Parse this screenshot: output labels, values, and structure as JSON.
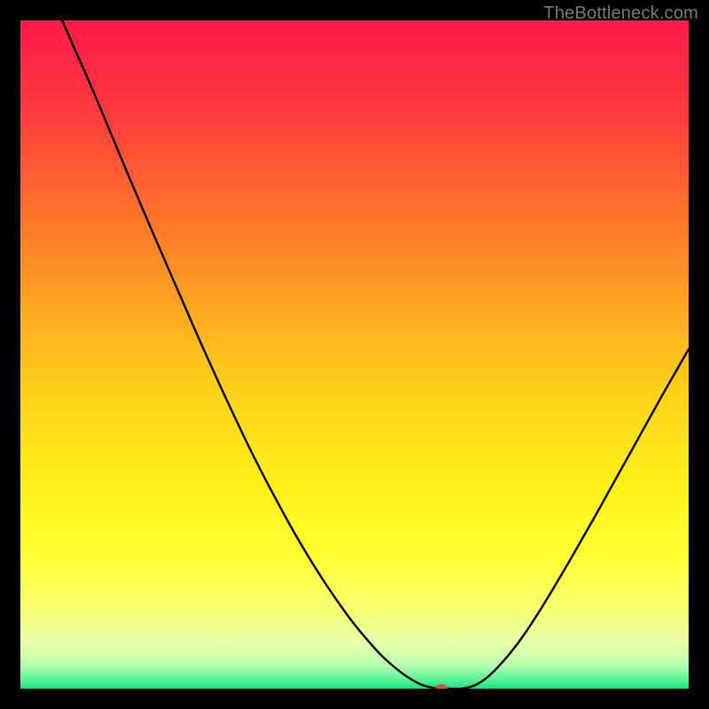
{
  "watermark": "TheBottleneck.com",
  "colors": {
    "marker_fill": "#c15a4d",
    "curve_stroke": "#000000",
    "gradient_stops": [
      {
        "offset": 0.0,
        "color": "#ff1a49"
      },
      {
        "offset": 0.14,
        "color": "#ff3b3e"
      },
      {
        "offset": 0.28,
        "color": "#ff6f2c"
      },
      {
        "offset": 0.42,
        "color": "#ffa322"
      },
      {
        "offset": 0.56,
        "color": "#ffd21a"
      },
      {
        "offset": 0.7,
        "color": "#fff01a"
      },
      {
        "offset": 0.8,
        "color": "#ffff33"
      },
      {
        "offset": 0.88,
        "color": "#f7ff70"
      },
      {
        "offset": 0.93,
        "color": "#e8ffa8"
      },
      {
        "offset": 0.965,
        "color": "#b8ffb0"
      },
      {
        "offset": 0.985,
        "color": "#60f59a"
      },
      {
        "offset": 1.0,
        "color": "#19e082"
      }
    ]
  },
  "chart_data": {
    "type": "line",
    "title": "",
    "xlabel": "",
    "ylabel": "",
    "xlim": [
      0,
      100
    ],
    "ylim": [
      0,
      100
    ],
    "x": [
      0,
      2,
      4,
      6,
      8,
      10,
      12,
      14,
      16,
      18,
      20,
      22,
      24,
      26,
      28,
      30,
      32,
      34,
      36,
      38,
      40,
      42,
      44,
      46,
      48,
      50,
      52,
      54,
      56,
      58,
      60,
      62,
      64,
      66,
      68,
      70,
      72,
      74,
      76,
      78,
      80,
      82,
      84,
      86,
      88,
      90,
      92,
      94,
      96,
      98,
      100
    ],
    "values": [
      104,
      104,
      104,
      100.5,
      96.0,
      91.5,
      86.8,
      82.0,
      77.2,
      72.5,
      67.8,
      63.2,
      58.6,
      54.0,
      49.5,
      45.1,
      40.8,
      36.6,
      32.6,
      28.8,
      25.1,
      21.6,
      18.3,
      15.2,
      12.3,
      9.6,
      7.2,
      5.0,
      3.2,
      1.7,
      0.6,
      0.1,
      0.0,
      0.0,
      0.5,
      1.8,
      3.8,
      6.2,
      9.0,
      12.1,
      15.4,
      18.8,
      22.3,
      25.8,
      29.4,
      33.0,
      36.6,
      40.2,
      43.8,
      47.3,
      50.8
    ],
    "marker": {
      "x": 63.0,
      "y": 0.0
    },
    "notes": "y = bottleneck percentage (0 at optimum). Values are read off the curve relative to the plot box; x runs left→right, y runs bottom→top. The curve visually exits above the top edge (y>100) for x≲5."
  }
}
